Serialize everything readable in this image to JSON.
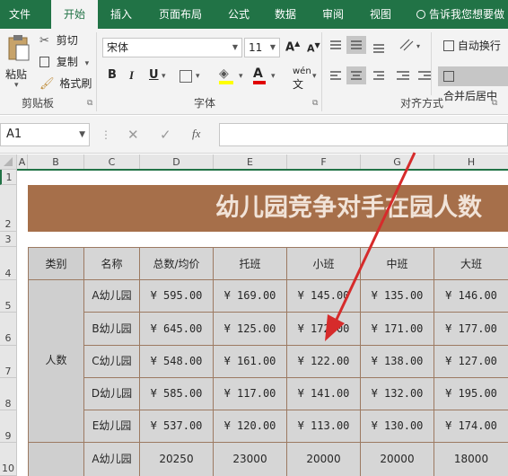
{
  "tabs": [
    "文件",
    "开始",
    "插入",
    "页面布局",
    "公式",
    "数据",
    "审阅",
    "视图"
  ],
  "tell_me": "告诉我您想要做",
  "clipboard": {
    "paste": "粘贴",
    "cut": "剪切",
    "copy": "复制",
    "format_painter": "格式刷",
    "group": "剪贴板"
  },
  "font": {
    "name": "宋体",
    "size": "11",
    "group": "字体",
    "bold": "B",
    "italic": "I",
    "underline": "U",
    "grow": "A",
    "shrink": "A",
    "wen": "wén"
  },
  "alignment": {
    "wrap": "自动换行",
    "merge": "合并后居中",
    "group": "对齐方式"
  },
  "formula_bar": {
    "name_box": "A1",
    "cancel": "✕",
    "enter": "✓",
    "fx": "fx",
    "value": ""
  },
  "columns": [
    "A",
    "B",
    "C",
    "D",
    "E",
    "F",
    "G",
    "H"
  ],
  "rows": [
    "1",
    "2",
    "3",
    "4",
    "5",
    "6",
    "7",
    "8",
    "9",
    "10"
  ],
  "sheet": {
    "title": "幼儿园竞争对手在园人数",
    "headers": [
      "类别",
      "名称",
      "总数/均价",
      "托班",
      "小班",
      "中班",
      "大班"
    ],
    "group1_label": "人数",
    "rows": [
      {
        "name": "A幼儿园",
        "total": "¥ 595.00",
        "c1": "¥ 169.00",
        "c2": "¥ 145.00",
        "c3": "¥ 135.00",
        "c4": "¥ 146.00"
      },
      {
        "name": "B幼儿园",
        "total": "¥ 645.00",
        "c1": "¥ 125.00",
        "c2": "¥ 172.00",
        "c3": "¥ 171.00",
        "c4": "¥ 177.00"
      },
      {
        "name": "C幼儿园",
        "total": "¥ 548.00",
        "c1": "¥ 161.00",
        "c2": "¥ 122.00",
        "c3": "¥ 138.00",
        "c4": "¥ 127.00"
      },
      {
        "name": "D幼儿园",
        "total": "¥ 585.00",
        "c1": "¥ 117.00",
        "c2": "¥ 141.00",
        "c3": "¥ 132.00",
        "c4": "¥ 195.00"
      },
      {
        "name": "E幼儿园",
        "total": "¥ 537.00",
        "c1": "¥ 120.00",
        "c2": "¥ 113.00",
        "c3": "¥ 130.00",
        "c4": "¥ 174.00"
      },
      {
        "name": "A幼儿园",
        "total": "20250",
        "c1": "23000",
        "c2": "20000",
        "c3": "20000",
        "c4": "18000"
      }
    ]
  },
  "colors": {
    "excel_green": "#217346",
    "title_fill": "#a66f4a",
    "label_fill": "#cfcfcf",
    "cell_fill": "#d6d6d6",
    "arrow": "#d62b2b"
  }
}
